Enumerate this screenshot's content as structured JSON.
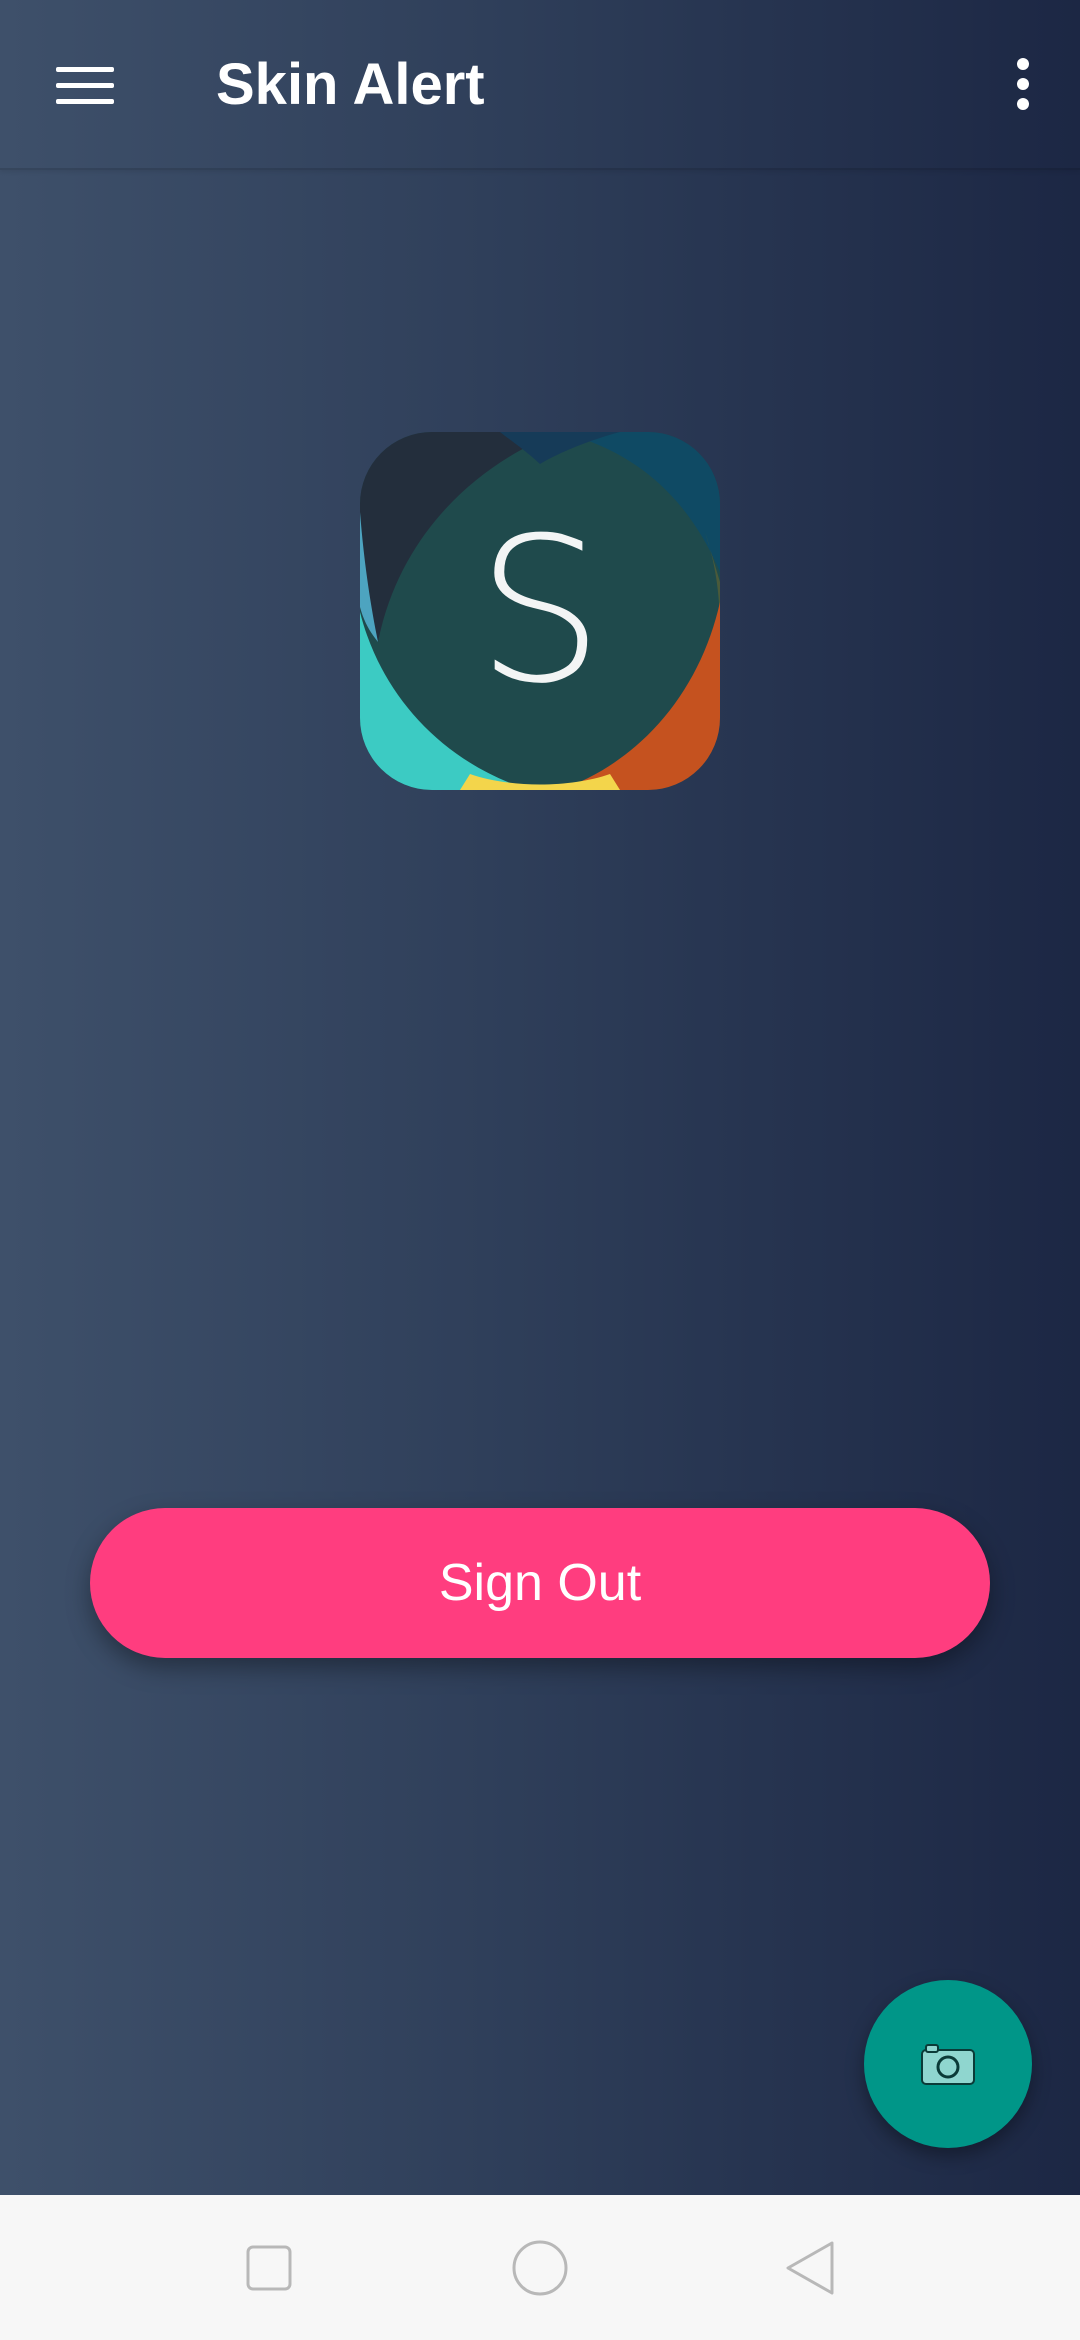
{
  "app_bar": {
    "title": "Skin Alert",
    "menu_icon": "hamburger-menu-icon",
    "overflow_icon": "more-vert-icon"
  },
  "logo": {
    "letter": "S",
    "colors": [
      "#232e3c",
      "#0f4a64",
      "#3ccbc3",
      "#c5521f",
      "#f3d54b",
      "#1f4a4c"
    ]
  },
  "sign_out_button": {
    "label": "Sign Out",
    "color": "#ff3d7f"
  },
  "fab": {
    "icon": "camera-icon",
    "color": "#009688"
  },
  "system_nav": {
    "items": [
      "recents-square-icon",
      "home-circle-icon",
      "back-triangle-icon"
    ]
  }
}
